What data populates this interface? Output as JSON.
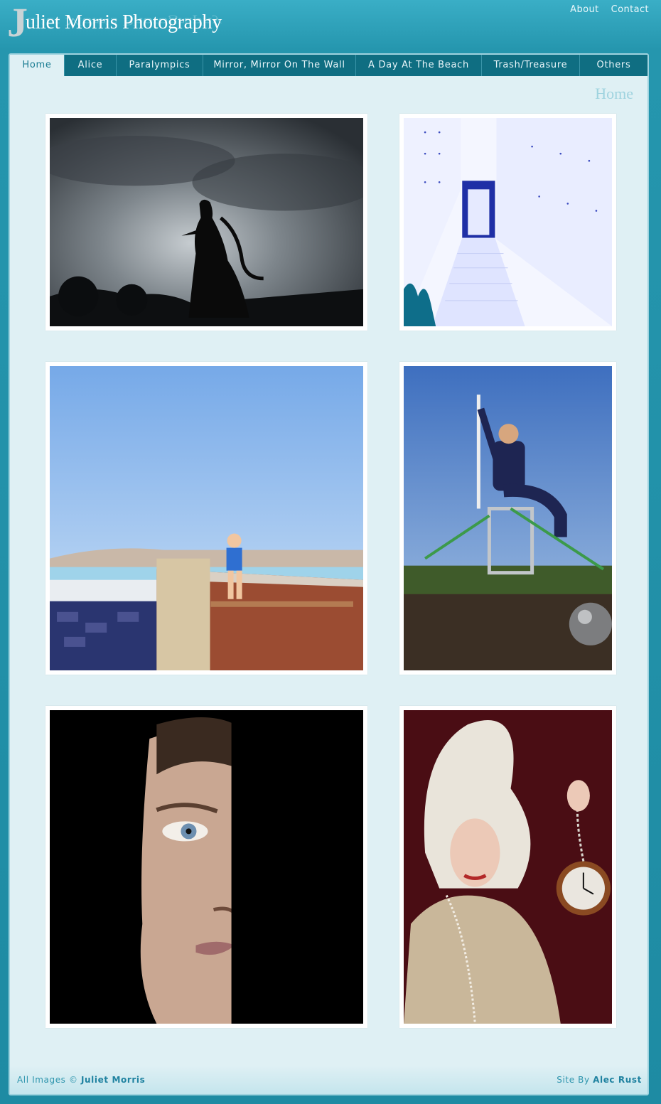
{
  "header": {
    "logo_initial": "J",
    "logo_text": "uliet Morris Photography",
    "links": [
      "About",
      "Contact"
    ]
  },
  "nav": {
    "tabs": [
      "Home",
      "Alice",
      "Paralympics",
      "Mirror, Mirror On The Wall",
      "A Day At The Beach",
      "Trash/Treasure",
      "Others"
    ],
    "active": "Home"
  },
  "page": {
    "title": "Home"
  },
  "footer": {
    "left_prefix": "All Images ©",
    "left_name": "Juliet Morris",
    "right_prefix": "Site By",
    "right_name": "Alec Rust"
  },
  "colors": {
    "header_bg": "#2596ae",
    "panel_bg": "#dff0f4",
    "nav_bg": "#0f6e82",
    "title": "#9fd3df"
  }
}
